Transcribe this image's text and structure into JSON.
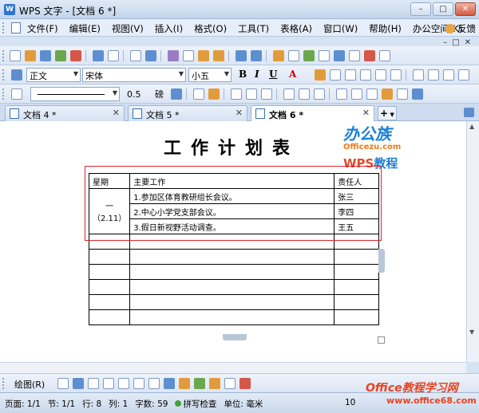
{
  "window": {
    "title": "WPS 文字 - [文档 6 *]"
  },
  "menu": {
    "items": [
      "文件(F)",
      "编辑(E)",
      "视图(V)",
      "插入(I)",
      "格式(O)",
      "工具(T)",
      "表格(A)",
      "窗口(W)",
      "帮助(H)",
      "办公空间(K)"
    ],
    "feedback": "反馈"
  },
  "format_toolbar": {
    "style": "正文",
    "font": "宋体",
    "size": "小五",
    "bold": "B",
    "italic": "I",
    "underline": "U",
    "font_color": "A"
  },
  "line_toolbar": {
    "weight": "0.5",
    "unit": "磅"
  },
  "tabs": [
    {
      "label": "文档 4 *",
      "active": false
    },
    {
      "label": "文档 5 *",
      "active": false
    },
    {
      "label": "文档 6 *",
      "active": true
    }
  ],
  "new_tab": "+",
  "document": {
    "title": "工作计划表",
    "table": {
      "headers": [
        "星期",
        "主要工作",
        "责任人"
      ],
      "day": "一",
      "date": "（2.11）",
      "rows": [
        {
          "work": "1.参加区体育教研组长会议。",
          "owner": "张三"
        },
        {
          "work": "2.中心小学党支部会议。",
          "owner": "李四"
        },
        {
          "work": "3.假日新视野活动调查。",
          "owner": "王五"
        }
      ],
      "empty_rows": 6
    }
  },
  "logo": {
    "main": "办公族",
    "sub": "Officezu.com",
    "wps": "WPS",
    "wps_suffix": "教程"
  },
  "drawbar": {
    "label": "绘图(R)"
  },
  "status": {
    "page": "页面: 1/1",
    "section": "节: 1/1",
    "line": "行: 8",
    "column": "列: 1",
    "word_count": "字数: 59",
    "spell": "拼写检查",
    "unit": "单位: 毫米",
    "zoom": "10"
  },
  "watermark": {
    "main": "Office教程学习网",
    "url": "www.office68.com"
  },
  "colors": {
    "selection": "#d9262e",
    "logo_blue": "#1b7fd8",
    "watermark": "#e8431f"
  }
}
